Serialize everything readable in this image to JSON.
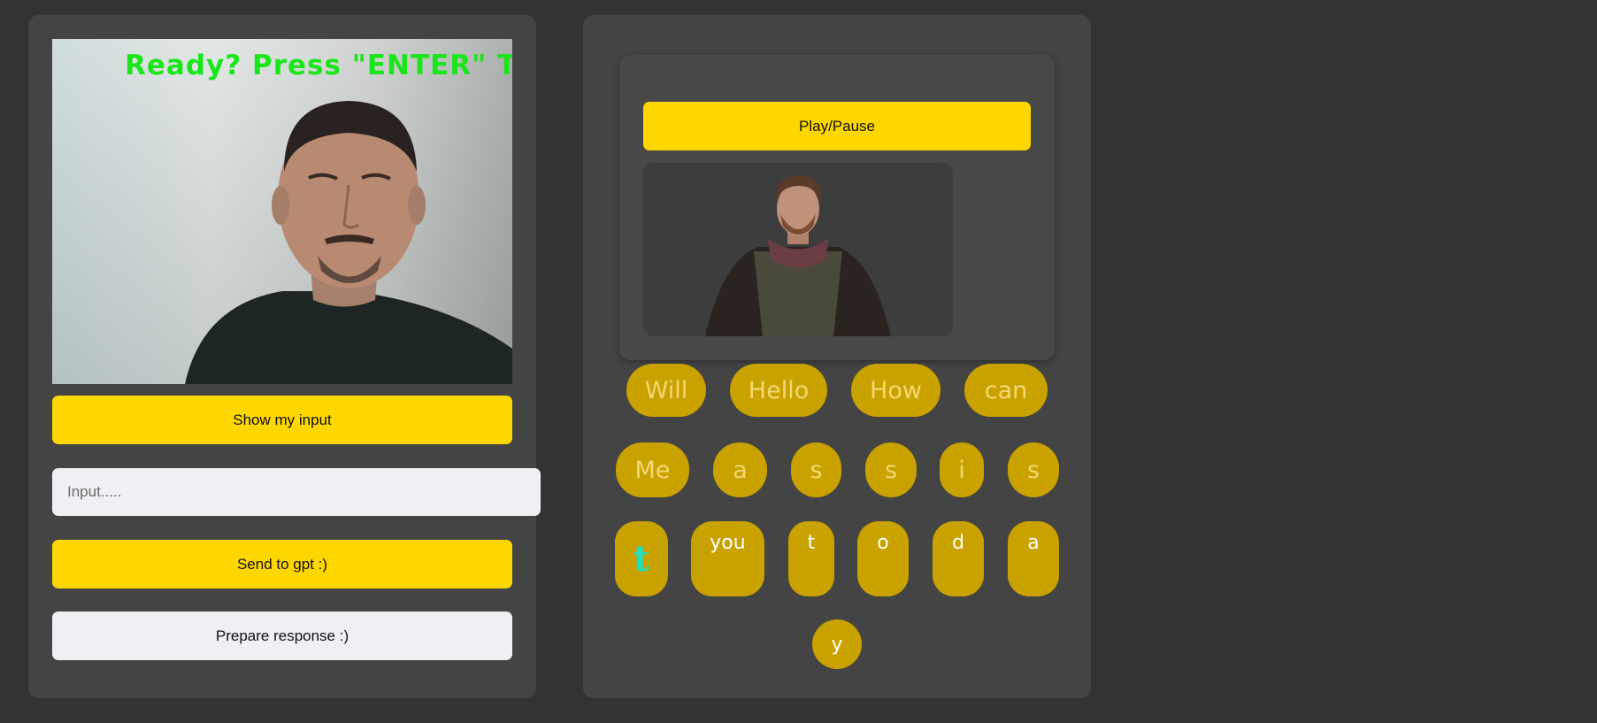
{
  "webcam": {
    "overlay_text": "Ready? Press \"ENTER\" TO"
  },
  "left": {
    "show_input_label": "Show my input",
    "input_placeholder": "Input.....",
    "input_value": "",
    "send_label": "Send to gpt :)",
    "prepare_label": "Prepare response :)"
  },
  "right": {
    "play_pause_label": "Play/Pause",
    "words": [
      "Will",
      "Hello",
      "How",
      "can"
    ],
    "letters_row2": [
      "Me",
      "a",
      "s",
      "s",
      "i",
      "s"
    ],
    "letters_row3": [
      "t",
      "you",
      "t",
      "o",
      "d",
      "a"
    ],
    "letters_row4": [
      "y"
    ]
  },
  "colors": {
    "background": "#333333",
    "panel": "#444444",
    "accent_yellow": "#ffd700",
    "chip": "#c9a200",
    "overlay_green": "#19e619",
    "teal": "#20e0c0"
  }
}
